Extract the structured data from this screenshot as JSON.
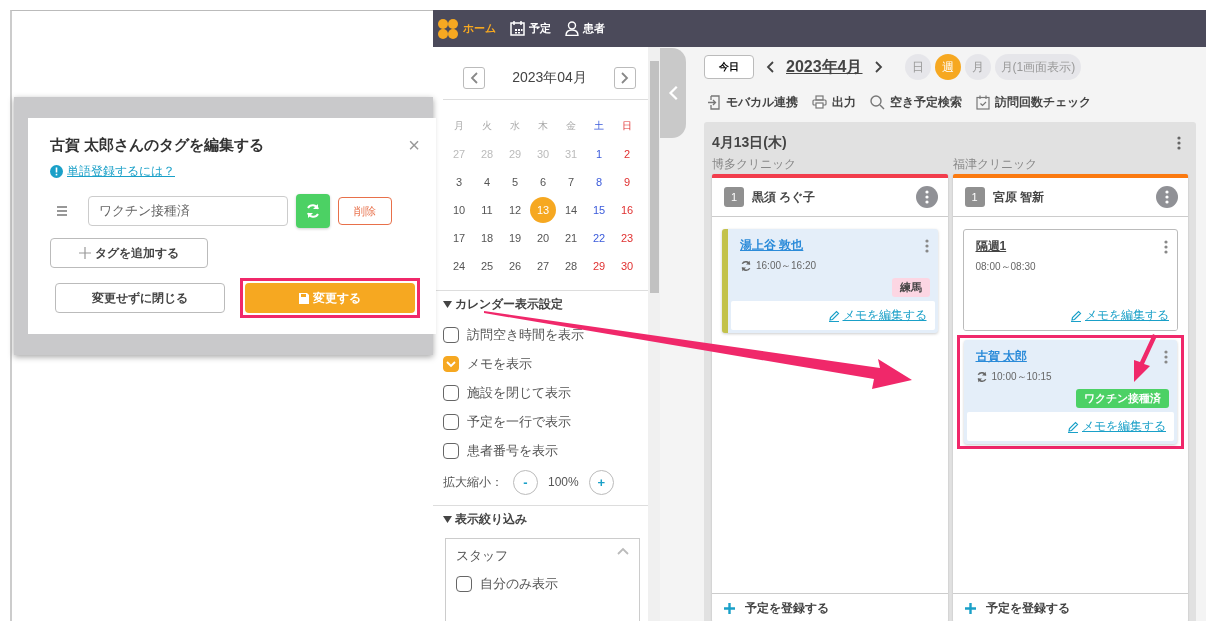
{
  "dialog": {
    "title": "古賀 太郎さんのタグを編集する",
    "close": "×",
    "help_link": "単語登録するには？",
    "tags": [
      {
        "value": "ワクチン接種済",
        "delete": "削除"
      }
    ],
    "add_button": "タグを追加する",
    "buttons": [
      {
        "label": "変更せずに閉じる",
        "kind": "secondary",
        "highlighted": false
      },
      {
        "label": "変更する",
        "kind": "primary",
        "highlighted": true
      }
    ]
  },
  "nav": {
    "items": [
      {
        "label": "ホーム",
        "kind": "home",
        "selected": true
      },
      {
        "label": "予定",
        "kind": "schedule",
        "selected": false
      },
      {
        "label": "患者",
        "kind": "patient",
        "selected": false
      }
    ]
  },
  "mini_calendar": {
    "month": "2023年04月",
    "weekdays": [
      {
        "label": "月",
        "kind": "weekday"
      },
      {
        "label": "火",
        "kind": "weekday"
      },
      {
        "label": "水",
        "kind": "weekday"
      },
      {
        "label": "木",
        "kind": "weekday"
      },
      {
        "label": "金",
        "kind": "weekday"
      },
      {
        "label": "土",
        "kind": "saturday"
      },
      {
        "label": "日",
        "kind": "sunday"
      }
    ],
    "weeks": [
      [
        {
          "day": "27",
          "kind": "outside",
          "selected": false
        },
        {
          "day": "28",
          "kind": "outside",
          "selected": false
        },
        {
          "day": "29",
          "kind": "outside",
          "selected": false
        },
        {
          "day": "30",
          "kind": "outside",
          "selected": false
        },
        {
          "day": "31",
          "kind": "outside",
          "selected": false
        },
        {
          "day": "1",
          "kind": "saturday",
          "selected": false
        },
        {
          "day": "2",
          "kind": "sunday",
          "selected": false
        }
      ],
      [
        {
          "day": "3",
          "kind": "weekday",
          "selected": false
        },
        {
          "day": "4",
          "kind": "weekday",
          "selected": false
        },
        {
          "day": "5",
          "kind": "weekday",
          "selected": false
        },
        {
          "day": "6",
          "kind": "weekday",
          "selected": false
        },
        {
          "day": "7",
          "kind": "weekday",
          "selected": false
        },
        {
          "day": "8",
          "kind": "saturday",
          "selected": false
        },
        {
          "day": "9",
          "kind": "sunday",
          "selected": false
        }
      ],
      [
        {
          "day": "10",
          "kind": "weekday",
          "selected": false
        },
        {
          "day": "11",
          "kind": "weekday",
          "selected": false
        },
        {
          "day": "12",
          "kind": "weekday",
          "selected": false
        },
        {
          "day": "13",
          "kind": "weekday",
          "selected": true
        },
        {
          "day": "14",
          "kind": "weekday",
          "selected": false
        },
        {
          "day": "15",
          "kind": "saturday",
          "selected": false
        },
        {
          "day": "16",
          "kind": "sunday",
          "selected": false
        }
      ],
      [
        {
          "day": "17",
          "kind": "weekday",
          "selected": false
        },
        {
          "day": "18",
          "kind": "weekday",
          "selected": false
        },
        {
          "day": "19",
          "kind": "weekday",
          "selected": false
        },
        {
          "day": "20",
          "kind": "weekday",
          "selected": false
        },
        {
          "day": "21",
          "kind": "weekday",
          "selected": false
        },
        {
          "day": "22",
          "kind": "saturday",
          "selected": false
        },
        {
          "day": "23",
          "kind": "sunday",
          "selected": false
        }
      ],
      [
        {
          "day": "24",
          "kind": "weekday",
          "selected": false
        },
        {
          "day": "25",
          "kind": "weekday",
          "selected": false
        },
        {
          "day": "26",
          "kind": "weekday",
          "selected": false
        },
        {
          "day": "27",
          "kind": "weekday",
          "selected": false
        },
        {
          "day": "28",
          "kind": "weekday",
          "selected": false
        },
        {
          "day": "29",
          "kind": "holiday",
          "selected": false
        },
        {
          "day": "30",
          "kind": "sunday",
          "selected": false
        }
      ]
    ]
  },
  "calendar_settings": {
    "title": "カレンダー表示設定",
    "expanded": true,
    "options": [
      {
        "label": "訪問空き時間を表示",
        "checked": false
      },
      {
        "label": "メモを表示",
        "checked": true
      },
      {
        "label": "施設を閉じて表示",
        "checked": false
      },
      {
        "label": "予定を一行で表示",
        "checked": false
      },
      {
        "label": "患者番号を表示",
        "checked": false
      }
    ],
    "zoom": {
      "label": "拡大縮小：",
      "minus": "-",
      "value": "100%",
      "plus": "+"
    }
  },
  "filter": {
    "title": "表示絞り込み",
    "expanded": true,
    "staff": {
      "title": "スタッフ",
      "expanded": true,
      "only_mine": {
        "label": "自分のみ表示",
        "checked": false
      }
    }
  },
  "toolbar": {
    "today": "今日",
    "period": "2023年4月",
    "views": [
      {
        "label": "日",
        "selected": false
      },
      {
        "label": "週",
        "selected": true
      },
      {
        "label": "月",
        "selected": false
      },
      {
        "label": "月(1画面表示)",
        "selected": false
      }
    ],
    "actions": [
      {
        "label": "モバカル連携",
        "kind": "import"
      },
      {
        "label": "出力",
        "kind": "print"
      },
      {
        "label": "空き予定検索",
        "kind": "search"
      },
      {
        "label": "訪問回数チェック",
        "kind": "calendar"
      }
    ]
  },
  "day": {
    "date": "4月13日(木)",
    "columns": [
      {
        "clinic": "博多クリニック",
        "color": "#f23d4c",
        "count": "1",
        "staff": "黒須 ろぐ子",
        "add": "予定を登録する",
        "appointments": [
          {
            "kind": "visit",
            "name": "湯上谷 敦也",
            "time": "16:00～16:20",
            "color": "#c3c24b",
            "highlighted": false,
            "tags": [
              {
                "label": "練馬",
                "color": "#fcd6e3"
              }
            ],
            "memo": "メモを編集する"
          }
        ]
      },
      {
        "clinic": "福津クリニック",
        "color": "#fb7a10",
        "count": "1",
        "staff": "宮原 智新",
        "add": "予定を登録する",
        "appointments": [
          {
            "kind": "event",
            "name": "隔週1",
            "time": "08:00～08:30",
            "highlighted": false,
            "memo": "メモを編集する"
          },
          {
            "kind": "visit",
            "name": "古賀 太郎",
            "time": "10:00～10:15",
            "highlighted": true,
            "tags": [
              {
                "label": "ワクチン接種済",
                "color": "#4cd165"
              }
            ],
            "memo": "メモを編集する"
          }
        ]
      }
    ]
  }
}
